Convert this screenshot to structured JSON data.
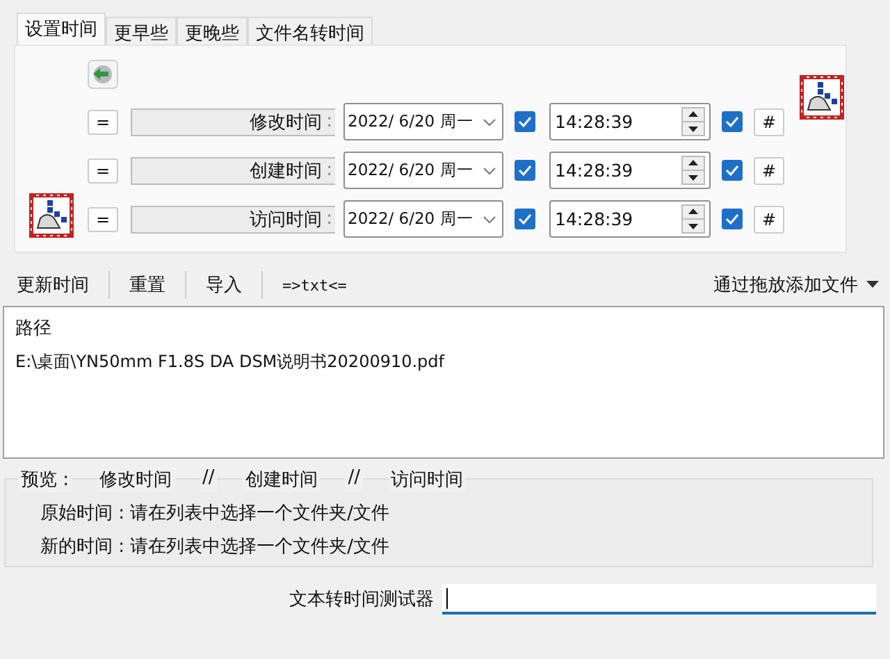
{
  "tabs": [
    {
      "label": "设置时间",
      "selected": true
    },
    {
      "label": "更早些",
      "selected": false
    },
    {
      "label": "更晚些",
      "selected": false
    },
    {
      "label": "文件名转时间",
      "selected": false
    }
  ],
  "time_rows": [
    {
      "equals": "=",
      "label": "修改时间",
      "separator": ":",
      "date": "2022/ 6/20 周一",
      "date_checked": true,
      "time": "14:28:39",
      "time_checked": true,
      "hash": "#"
    },
    {
      "equals": "=",
      "label": "创建时间",
      "separator": ":",
      "date": "2022/ 6/20 周一",
      "date_checked": true,
      "time": "14:28:39",
      "time_checked": true,
      "hash": "#"
    },
    {
      "equals": "=",
      "label": "访问时间",
      "separator": ":",
      "date": "2022/ 6/20 周一",
      "date_checked": true,
      "time": "14:28:39",
      "time_checked": true,
      "hash": "#"
    }
  ],
  "toolbar": {
    "buttons": [
      "更新时间",
      "重置",
      "导入",
      "=>txt<="
    ],
    "drop_menu": "通过拖放添加文件"
  },
  "file_list": {
    "header": "路径",
    "rows": [
      "E:\\桌面\\YN50mm F1.8S DA DSM说明书20200910.pdf"
    ]
  },
  "preview": {
    "legend": [
      "预览 :",
      "修改时间",
      "//",
      "创建时间",
      "//",
      "访问时间"
    ],
    "lines": [
      "原始时间 : 请在列表中选择一个文件夹/文件",
      "新的时间 : 请在列表中选择一个文件夹/文件"
    ]
  },
  "tester": {
    "label": "文本转时间测试器"
  }
}
